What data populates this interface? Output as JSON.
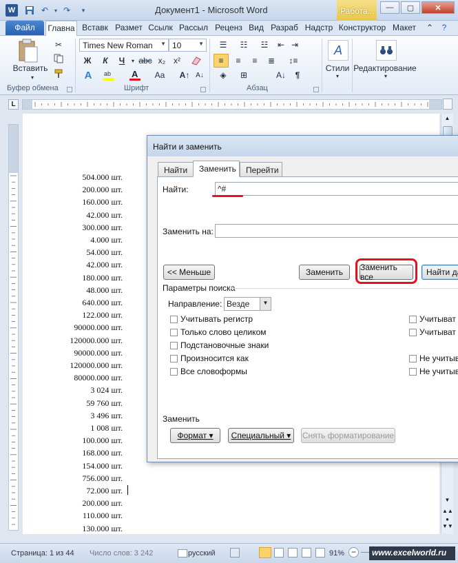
{
  "window": {
    "title": "Документ1 - Microsoft Word",
    "context_tab": "Работа...",
    "logo_letter": "W"
  },
  "tabs": [
    "Файл",
    "Главна",
    "Вставк",
    "Размет",
    "Ссылк",
    "Рассыл",
    "Реценз",
    "Вид",
    "Разраб",
    "Надстр",
    "Конструктор",
    "Макет"
  ],
  "ribbon": {
    "paste_label": "Вставить",
    "font_name": "Times New Roman",
    "font_size": "10",
    "bold": "Ж",
    "italic": "К",
    "underline": "Ч",
    "styles_label": "Стили",
    "editing_label": "Редактирование",
    "groups": {
      "clipboard": "Буфер обмена",
      "font": "Шрифт",
      "paragraph": "Абзац"
    }
  },
  "document": {
    "values": [
      "504.000 шт.",
      "200.000 шт.",
      "160.000 шт.",
      "42.000 шт.",
      "300.000 шт.",
      "4.000 шт.",
      "54.000 шт.",
      "42.000 шт.",
      "180.000 шт.",
      "48.000 шт.",
      "640.000 шт.",
      "122.000 шт.",
      "90000.000 шт.",
      "120000.000 шт.",
      "90000.000 шт.",
      "120000.000 шт.",
      "80000.000 шт.",
      "3 024 шт.",
      "59 760 шт.",
      "3 496 шт.",
      "1 008 шт.",
      "100.000 шт.",
      "168.000 шт.",
      "154.000 шт.",
      "756.000 шт.",
      "72.000 шт.",
      "200.000 шт.",
      "110.000 шт.",
      "130.000 шт."
    ]
  },
  "dialog": {
    "title": "Найти и заменить",
    "tabs": [
      "Найти",
      "Заменить",
      "Перейти"
    ],
    "find_label": "Найти:",
    "find_value": "^#",
    "replace_label": "Заменить на:",
    "replace_value": "",
    "less_button": "<< Меньше",
    "replace_button": "Заменить",
    "replace_all_button": "Заменить все",
    "find_next_button": "Найти да",
    "search_options_label": "Параметры поиска",
    "direction_label": "Направление:",
    "direction_value": "Везде",
    "options_left": [
      "Учитывать регистр",
      "Только слово целиком",
      "Подстановочные знаки",
      "Произносится как",
      "Все словоформы"
    ],
    "options_right": [
      "Учитыват",
      "Учитыват",
      "Не учитыв",
      "Не учитыв"
    ],
    "replace_section_label": "Заменить",
    "format_button": "Формат ▾",
    "special_button": "Специальный ▾",
    "no_formatting_button": "Снять форматирование"
  },
  "status": {
    "page": "Страница: 1 из 44",
    "words": "Число слов: 3 242",
    "language": "русский",
    "zoom": "91%",
    "watermark": "www.excelworld.ru"
  }
}
